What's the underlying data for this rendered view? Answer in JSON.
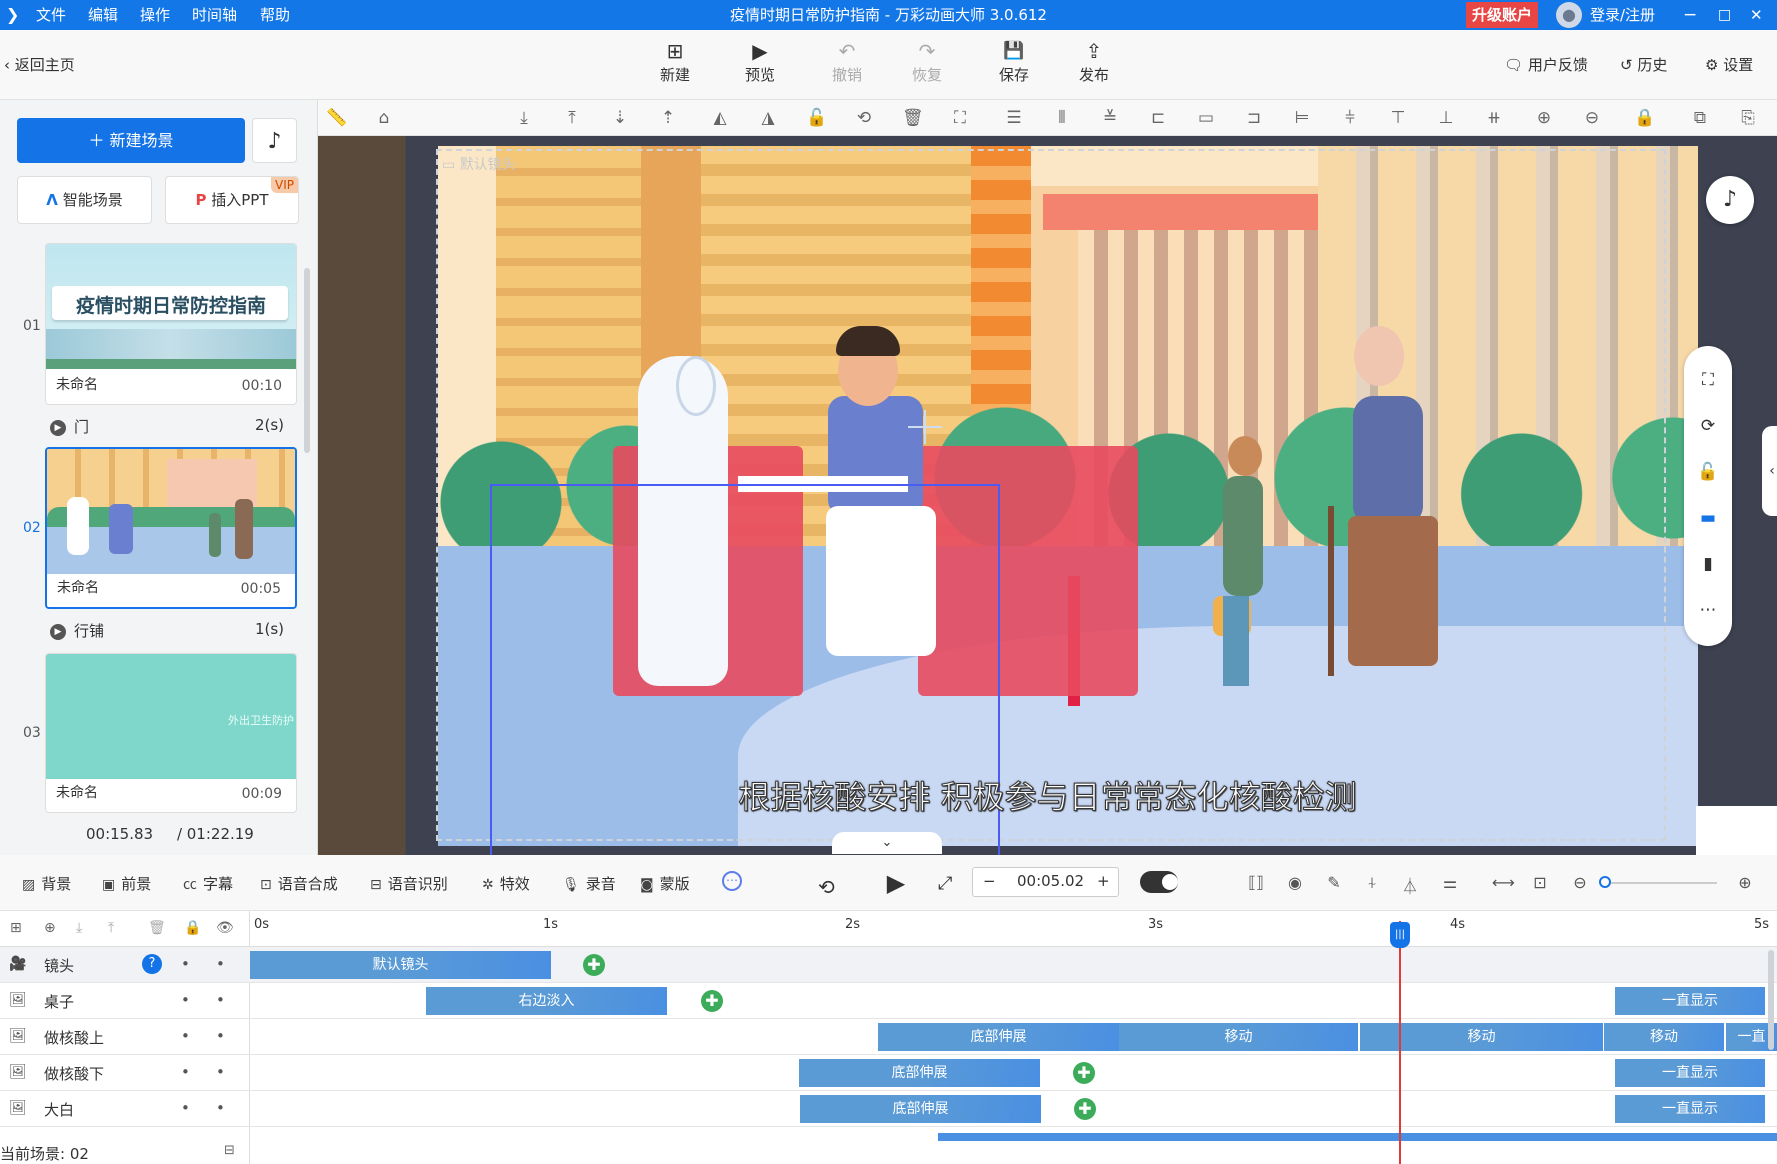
{
  "app": {
    "title": "疫情时期日常防护指南 - 万彩动画大师 3.0.612",
    "menu": [
      "文件",
      "编辑",
      "操作",
      "时间轴",
      "帮助"
    ],
    "upgrade": "升级账户",
    "login": "登录/注册",
    "win_controls": {
      "minimize": "−",
      "maximize": "□",
      "close": "✕"
    }
  },
  "toolbar": {
    "back": "返回主页",
    "buttons": [
      {
        "label": "新建",
        "icon": "plus-square-icon",
        "glyph": "⊞",
        "enabled": true
      },
      {
        "label": "预览",
        "icon": "play-icon",
        "glyph": "▶",
        "enabled": true
      },
      {
        "label": "撤销",
        "icon": "undo-icon",
        "glyph": "↶",
        "enabled": false
      },
      {
        "label": "恢复",
        "icon": "redo-icon",
        "glyph": "↷",
        "enabled": false
      },
      {
        "label": "保存",
        "icon": "save-icon",
        "glyph": "💾",
        "enabled": true
      },
      {
        "label": "发布",
        "icon": "publish-icon",
        "glyph": "⇪",
        "enabled": true
      }
    ],
    "feedback": "用户反馈",
    "history": "历史",
    "settings": "设置"
  },
  "sidebar": {
    "new_scene": "新建场景",
    "smart_scene": "智能场景",
    "insert_ppt": "插入PPT",
    "vip": "VIP",
    "scenes": [
      {
        "num": "01",
        "name": "未命名",
        "time": "00:10",
        "thumb_text": "疫情时期日常防控指南"
      },
      {
        "num": "02",
        "name": "未命名",
        "time": "00:05",
        "thumb_text": ""
      },
      {
        "num": "03",
        "name": "未命名",
        "time": "00:09",
        "thumb_text": "外出卫生防护"
      }
    ],
    "transitions": [
      {
        "name": "门",
        "duration": "2(s)"
      },
      {
        "name": "行铺",
        "duration": "1(s)"
      }
    ],
    "current_time": "00:15.83",
    "total_time": "/ 01:22.19"
  },
  "canvas": {
    "frame_label": "默认镜头",
    "subtitle": "根据核酸安排 积极参与日常常态化核酸检测"
  },
  "timeline_toolbar": {
    "tools": [
      {
        "label": "背景",
        "glyph": "▨"
      },
      {
        "label": "前景",
        "glyph": "▣"
      },
      {
        "label": "字幕",
        "glyph": "㏄"
      },
      {
        "label": "语音合成",
        "glyph": "⊡"
      },
      {
        "label": "语音识别",
        "glyph": "⊟"
      },
      {
        "label": "特效",
        "glyph": "✲"
      },
      {
        "label": "录音",
        "glyph": "🎙"
      },
      {
        "label": "蒙版",
        "glyph": "◙"
      }
    ],
    "time_value": "00:05.02"
  },
  "timeline": {
    "ruler": [
      "0s",
      "1s",
      "2s",
      "3s",
      "4s",
      "5s"
    ],
    "layers": [
      {
        "name": "镜头",
        "help": "?"
      },
      {
        "name": "桌子"
      },
      {
        "name": "做核酸上"
      },
      {
        "name": "做核酸下"
      },
      {
        "name": "大白"
      }
    ],
    "clips": {
      "camera": [
        "默认镜头"
      ],
      "desk": [
        "右边淡入",
        "一直显示"
      ],
      "test_up": [
        "底部伸展",
        "移动",
        "移动",
        "移动",
        "一直"
      ],
      "test_down": [
        "底部伸展",
        "一直显示"
      ],
      "dabai": [
        "底部伸展",
        "一直显示"
      ]
    },
    "current_scene": "当前场景: 02"
  }
}
